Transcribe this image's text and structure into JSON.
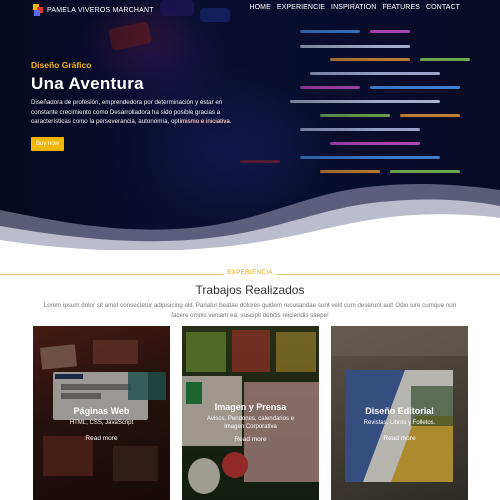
{
  "nav": {
    "brand": "PAMELA VIVEROS MARCHANT",
    "items": [
      "HOME",
      "EXPERIENCIE",
      "INSPIRATION",
      "FEATURES",
      "CONTACT"
    ]
  },
  "hero": {
    "eyebrow": "Diseño Gráfico",
    "title": "Una Aventura",
    "description": "Diseñadora de profesión, emprendedora por determinación y estar en constante crecimiento como Desarrolladora ha sido posible gracias a características como la perseverancia, autonomía, optimismo e iniciativa.",
    "button": "Buy now"
  },
  "section": {
    "eyebrow": "EXPERIENCIA",
    "title": "Trabajos Realizados",
    "description": "Lorem ipsum dolor sit amet consectetur adipisicing elit. Pariatur beatae dolores quidem recusandae sunt velit cum deserunt aut! Odio iure cumque non facere omnis veniam ea, suscipit debitis reiciendis saepe!"
  },
  "cards": [
    {
      "title": "Páginas Web",
      "subtitle": "HTML, CSS, JavaScript",
      "more": "Read more"
    },
    {
      "title": "Imagen y Prensa",
      "subtitle": "Avisos, Pendones, calendarios e Imagen Corporativa",
      "more": "Read more"
    },
    {
      "title": "Diseño Editorial",
      "subtitle": "Revistas, Libros y Folletos.",
      "more": "Read more"
    }
  ],
  "colors": {
    "accent": "#f3b600",
    "hero_bg": "#0b0f2e",
    "wave": "#ffffff"
  }
}
